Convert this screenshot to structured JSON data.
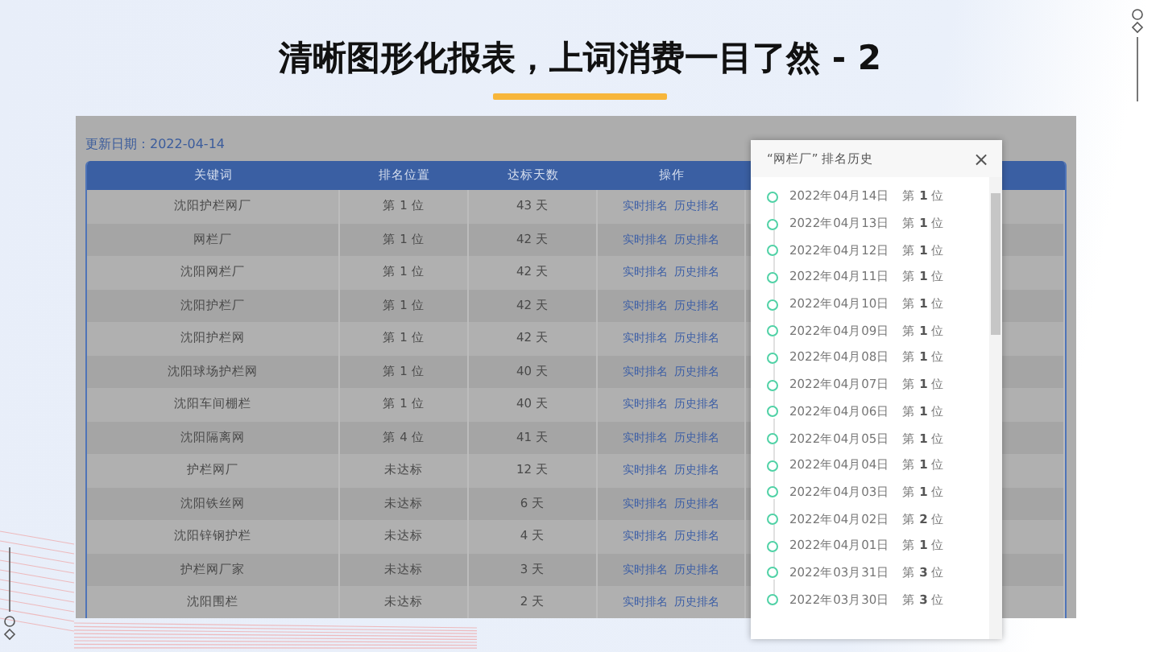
{
  "slide": {
    "title": "清晰图形化报表，上词消费一目了然 - 2"
  },
  "report": {
    "update_date": "更新日期：2022-04-14",
    "columns": [
      "关键词",
      "排名位置",
      "达标天数",
      "操作"
    ],
    "rows": [
      {
        "keyword": "沈阳护栏网厂",
        "rank": "第 1 位",
        "days": "43 天",
        "actions": [
          "实时排名",
          "历史排名"
        ]
      },
      {
        "keyword": "网栏厂",
        "rank": "第 1 位",
        "days": "42 天",
        "actions": [
          "实时排名",
          "历史排名"
        ]
      },
      {
        "keyword": "沈阳网栏厂",
        "rank": "第 1 位",
        "days": "42 天",
        "actions": [
          "实时排名",
          "历史排名"
        ]
      },
      {
        "keyword": "沈阳护栏厂",
        "rank": "第 1 位",
        "days": "42 天",
        "actions": [
          "实时排名",
          "历史排名"
        ]
      },
      {
        "keyword": "沈阳护栏网",
        "rank": "第 1 位",
        "days": "42 天",
        "actions": [
          "实时排名",
          "历史排名"
        ]
      },
      {
        "keyword": "沈阳球场护栏网",
        "rank": "第 1 位",
        "days": "40 天",
        "actions": [
          "实时排名",
          "历史排名"
        ]
      },
      {
        "keyword": "沈阳车间棚栏",
        "rank": "第 1 位",
        "days": "40 天",
        "actions": [
          "实时排名",
          "历史排名"
        ]
      },
      {
        "keyword": "沈阳隔离网",
        "rank": "第 4 位",
        "days": "41 天",
        "actions": [
          "实时排名",
          "历史排名"
        ]
      },
      {
        "keyword": "护栏网厂",
        "rank": "未达标",
        "days": "12 天",
        "actions": [
          "实时排名",
          "历史排名"
        ]
      },
      {
        "keyword": "沈阳铁丝网",
        "rank": "未达标",
        "days": "6 天",
        "actions": [
          "实时排名",
          "历史排名"
        ]
      },
      {
        "keyword": "沈阳锌钢护栏",
        "rank": "未达标",
        "days": "4 天",
        "actions": [
          "实时排名",
          "历史排名"
        ]
      },
      {
        "keyword": "护栏网厂家",
        "rank": "未达标",
        "days": "3 天",
        "actions": [
          "实时排名",
          "历史排名"
        ]
      },
      {
        "keyword": "沈阳围栏",
        "rank": "未达标",
        "days": "2 天",
        "actions": [
          "实时排名",
          "历史排名"
        ]
      }
    ]
  },
  "history_dialog": {
    "title": "“网栏厂” 排名历史",
    "close": "×",
    "items": [
      {
        "date": "2022年04月14日",
        "rank": "第 **1** 位"
      },
      {
        "date": "2022年04月13日",
        "rank": "第 **1** 位"
      },
      {
        "date": "2022年04月12日",
        "rank": "第 **1** 位"
      },
      {
        "date": "2022年04月11日",
        "rank": "第 **1** 位"
      },
      {
        "date": "2022年04月10日",
        "rank": "第 **1** 位"
      },
      {
        "date": "2022年04月09日",
        "rank": "第 **1** 位"
      },
      {
        "date": "2022年04月08日",
        "rank": "第 **1** 位"
      },
      {
        "date": "2022年04月07日",
        "rank": "第 **1** 位"
      },
      {
        "date": "2022年04月06日",
        "rank": "第 **1** 位"
      },
      {
        "date": "2022年04月05日",
        "rank": "第 **1** 位"
      },
      {
        "date": "2022年04月04日",
        "rank": "第 **1** 位"
      },
      {
        "date": "2022年04月03日",
        "rank": "第 **1** 位"
      },
      {
        "date": "2022年04月02日",
        "rank": "第 **2** 位"
      },
      {
        "date": "2022年04月01日",
        "rank": "第 **1** 位"
      },
      {
        "date": "2022年03月31日",
        "rank": "第 **3** 位"
      },
      {
        "date": "2022年03月30日",
        "rank": "第 **3** 位"
      }
    ]
  }
}
